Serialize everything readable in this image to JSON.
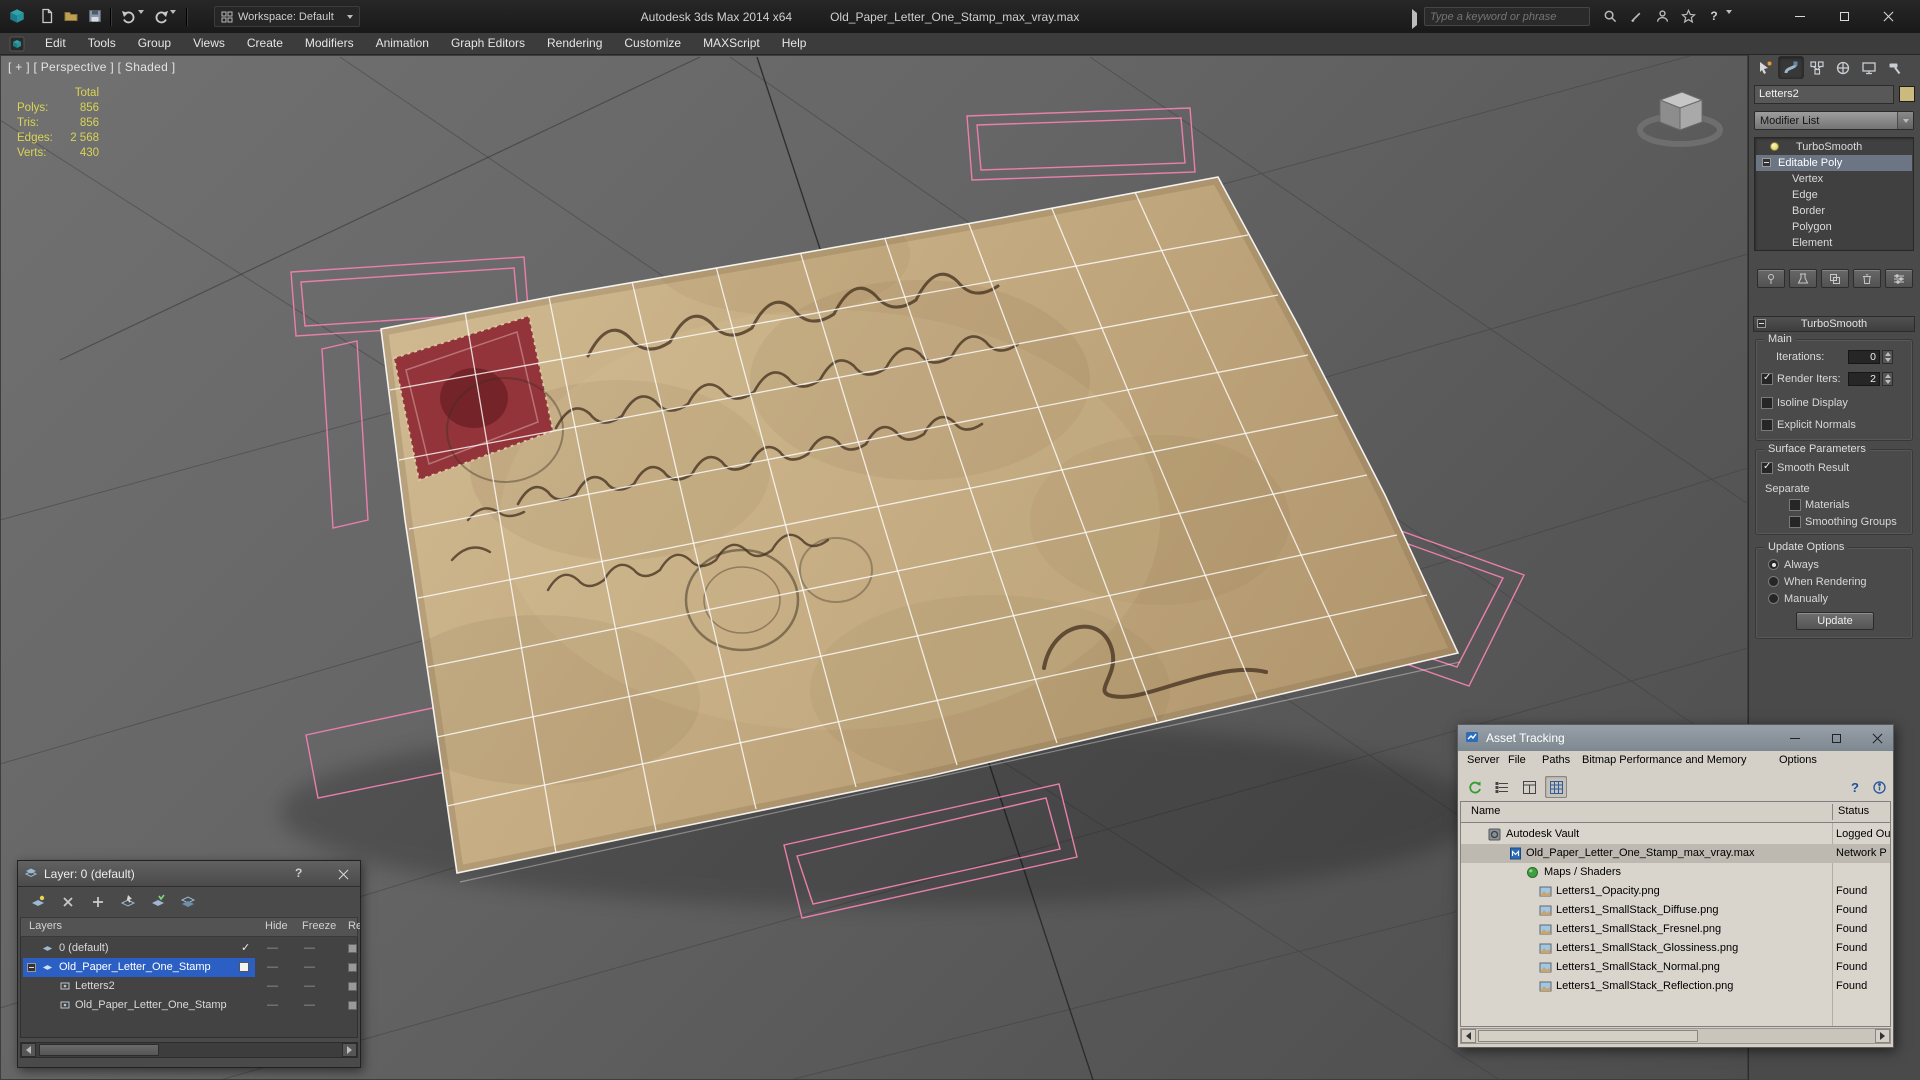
{
  "titlebar": {
    "workspace": "Workspace: Default",
    "app_title": "Autodesk 3ds Max  2014 x64",
    "doc_title": "Old_Paper_Letter_One_Stamp_max_vray.max",
    "search_placeholder": "Type a keyword or phrase"
  },
  "menubar": {
    "items": [
      "Edit",
      "Tools",
      "Group",
      "Views",
      "Create",
      "Modifiers",
      "Animation",
      "Graph Editors",
      "Rendering",
      "Customize",
      "MAXScript",
      "Help"
    ]
  },
  "viewport": {
    "label": "[ + ] [ Perspective ] [ Shaded ]",
    "stats": {
      "total": "Total",
      "rows": [
        {
          "label": "Polys:",
          "value": "856"
        },
        {
          "label": "Tris:",
          "value": "856"
        },
        {
          "label": "Edges:",
          "value": "2 568"
        },
        {
          "label": "Verts:",
          "value": "430"
        }
      ]
    }
  },
  "command_panel": {
    "object_name": "Letters2",
    "modifier_list": "Modifier List",
    "stack": [
      {
        "label": "TurboSmooth"
      },
      {
        "label": "Editable Poly"
      },
      {
        "label": "Vertex"
      },
      {
        "label": "Edge"
      },
      {
        "label": "Border"
      },
      {
        "label": "Polygon"
      },
      {
        "label": "Element"
      }
    ],
    "turbosmooth": {
      "title": "TurboSmooth",
      "main": "Main",
      "iterations": "Iterations:",
      "iterations_value": "0",
      "render_iters": "Render Iters:",
      "render_iters_value": "2",
      "isoline": "Isoline Display",
      "explicit_normals": "Explicit Normals",
      "surface": "Surface Parameters",
      "smooth_result": "Smooth Result",
      "separate": "Separate",
      "materials": "Materials",
      "smoothing_groups": "Smoothing Groups",
      "update_options": "Update Options",
      "always": "Always",
      "when_rendering": "When Rendering",
      "manually": "Manually",
      "update": "Update"
    }
  },
  "layer_dialog": {
    "title": "Layer: 0 (default)",
    "columns": [
      "Layers",
      "Hide",
      "Freeze",
      "Ren"
    ],
    "rows": [
      {
        "name": "0 (default)"
      },
      {
        "name": "Old_Paper_Letter_One_Stamp"
      },
      {
        "name": "Letters2"
      },
      {
        "name": "Old_Paper_Letter_One_Stamp"
      }
    ]
  },
  "asset_tracking": {
    "title": "Asset Tracking",
    "menu": [
      "Server",
      "File",
      "Paths",
      "Bitmap Performance and Memory",
      "Options"
    ],
    "columns": [
      "Name",
      "Status"
    ],
    "rows": [
      {
        "name": "Autodesk Vault",
        "status": "Logged Ou"
      },
      {
        "name": "Old_Paper_Letter_One_Stamp_max_vray.max",
        "status": "Network P"
      },
      {
        "name": "Maps / Shaders",
        "status": ""
      },
      {
        "name": "Letters1_Opacity.png",
        "status": "Found"
      },
      {
        "name": "Letters1_SmallStack_Diffuse.png",
        "status": "Found"
      },
      {
        "name": "Letters1_SmallStack_Fresnel.png",
        "status": "Found"
      },
      {
        "name": "Letters1_SmallStack_Glossiness.png",
        "status": "Found"
      },
      {
        "name": "Letters1_SmallStack_Normal.png",
        "status": "Found"
      },
      {
        "name": "Letters1_SmallStack_Reflection.png",
        "status": "Found"
      }
    ]
  },
  "colors": {
    "selection_blue": "#2c5fc4",
    "stats_yellow": "#d9d455",
    "open_edge_pink": "#ea7fab",
    "wireframe": "#ffffff",
    "paper": "#c4ab82"
  }
}
